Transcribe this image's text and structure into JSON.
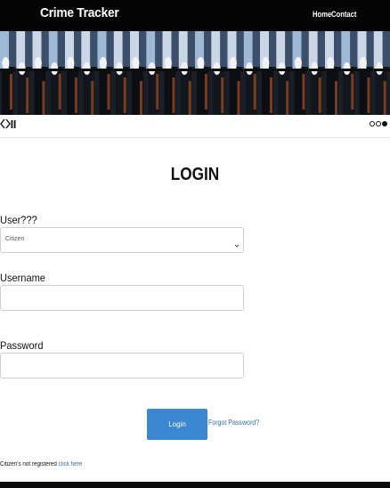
{
  "navbar": {
    "brand": "Crime Tracker",
    "links": [
      "Home",
      "Contact"
    ]
  },
  "slider": {
    "slide_count": 3,
    "active_slide": 3
  },
  "form": {
    "title": "LOGIN",
    "user_type_label": "User???",
    "user_type_value": "Citizen",
    "username_label": "Username",
    "password_label": "Password",
    "login_button": "Login",
    "forgot_password": "Forgot Password?"
  },
  "footer": {
    "register_text": "Citizen's not registered",
    "register_link": "click here"
  },
  "colors": {
    "navbar_bg": "#050505",
    "button_bg": "#3b87d2",
    "link": "#2f6fb6"
  }
}
